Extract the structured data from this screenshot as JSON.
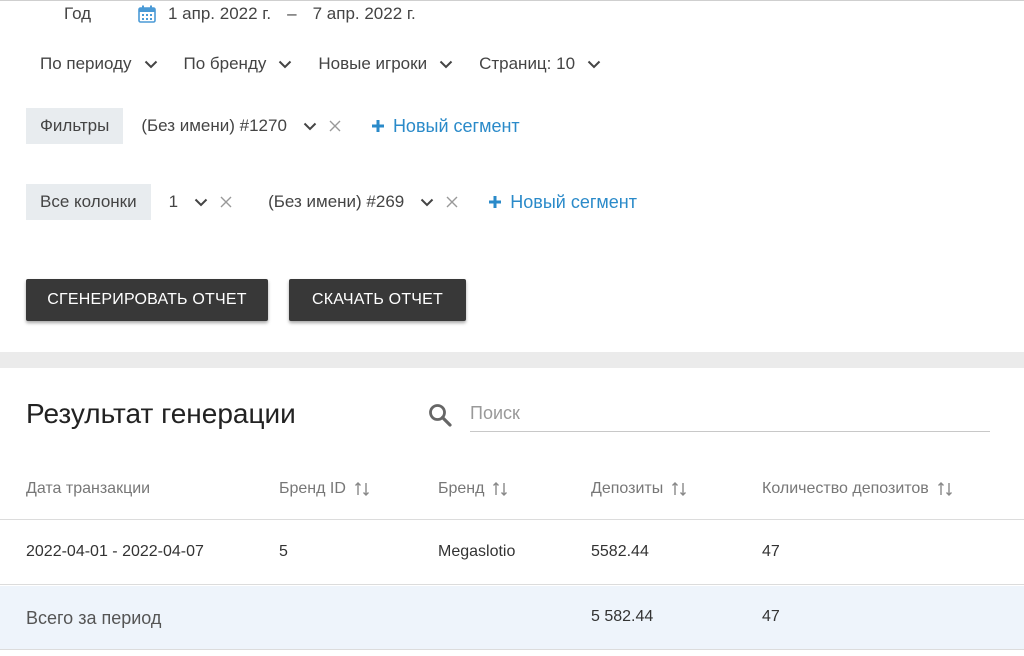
{
  "date_filter": {
    "period_label": "Год",
    "start": "1 апр. 2022 г.",
    "separator": "–",
    "end": "7 апр. 2022 г."
  },
  "dropdowns": {
    "period": "По периоду",
    "brand": "По бренду",
    "players": "Новые игроки",
    "pages": "Страниц: 10"
  },
  "filters": {
    "label": "Фильтры",
    "segment": "(Без имени) #1270",
    "new_segment": "Новый сегмент"
  },
  "columns": {
    "label": "Все колонки",
    "value": "1",
    "segment": "(Без имени) #269",
    "new_segment": "Новый сегмент"
  },
  "actions": {
    "generate": "СГЕНЕРИРОВАТЬ ОТЧЕТ",
    "download": "СКАЧАТЬ ОТЧЕТ"
  },
  "result": {
    "title": "Результат генерации",
    "search_placeholder": "Поиск"
  },
  "table": {
    "headers": [
      "Дата транзакции",
      "Бренд ID",
      "Бренд",
      "Депозиты",
      "Количество депозитов"
    ],
    "rows": [
      [
        "2022-04-01 - 2022-04-07",
        "5",
        "Megaslotio",
        "5582.44",
        "47"
      ]
    ],
    "total": {
      "label": "Всего за период",
      "deposits": "5 582.44",
      "count": "47"
    }
  },
  "colors": {
    "accent": "#2a8ac9",
    "button_bg": "#383838",
    "total_row_bg": "#eef4fb"
  },
  "icons": {
    "calendar": "calendar-icon",
    "chevron": "chevron-down-icon",
    "close": "close-icon",
    "plus": "plus-icon",
    "search": "search-icon",
    "sort": "sort-icon"
  }
}
